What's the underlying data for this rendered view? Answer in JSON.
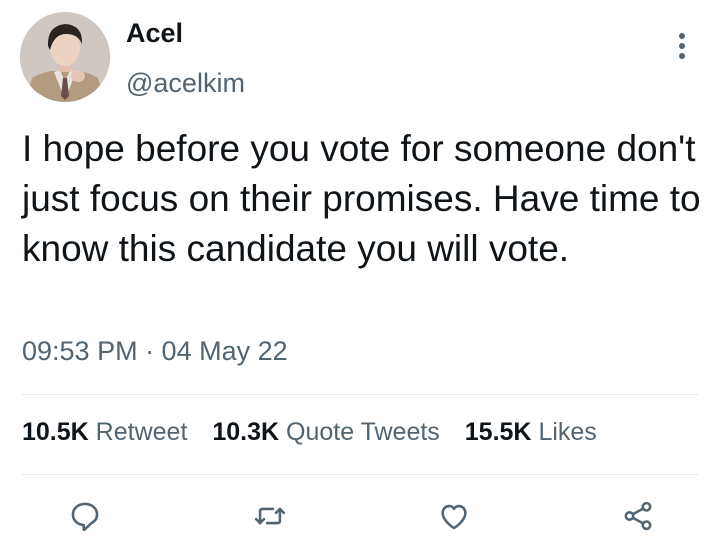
{
  "user": {
    "name": "Acel",
    "handle": "@acelkim"
  },
  "tweet": {
    "text": "I hope before you vote for someone don't just focus on their promises. Have time to know this candidate you will vote.",
    "timestamp": "09:53 PM · 04 May 22"
  },
  "stats": {
    "retweets": {
      "count": "10.5K",
      "label": "Retweet"
    },
    "quotes": {
      "count": "10.3K",
      "label": "Quote Tweets"
    },
    "likes": {
      "count": "15.5K",
      "label": "Likes"
    }
  },
  "actions": {
    "icons": [
      "reply-icon",
      "retweet-icon",
      "like-icon",
      "share-icon"
    ]
  },
  "colors": {
    "text_primary": "#0f1419",
    "text_secondary": "#536471",
    "divider": "#e6e8ea",
    "icon": "#536471"
  }
}
